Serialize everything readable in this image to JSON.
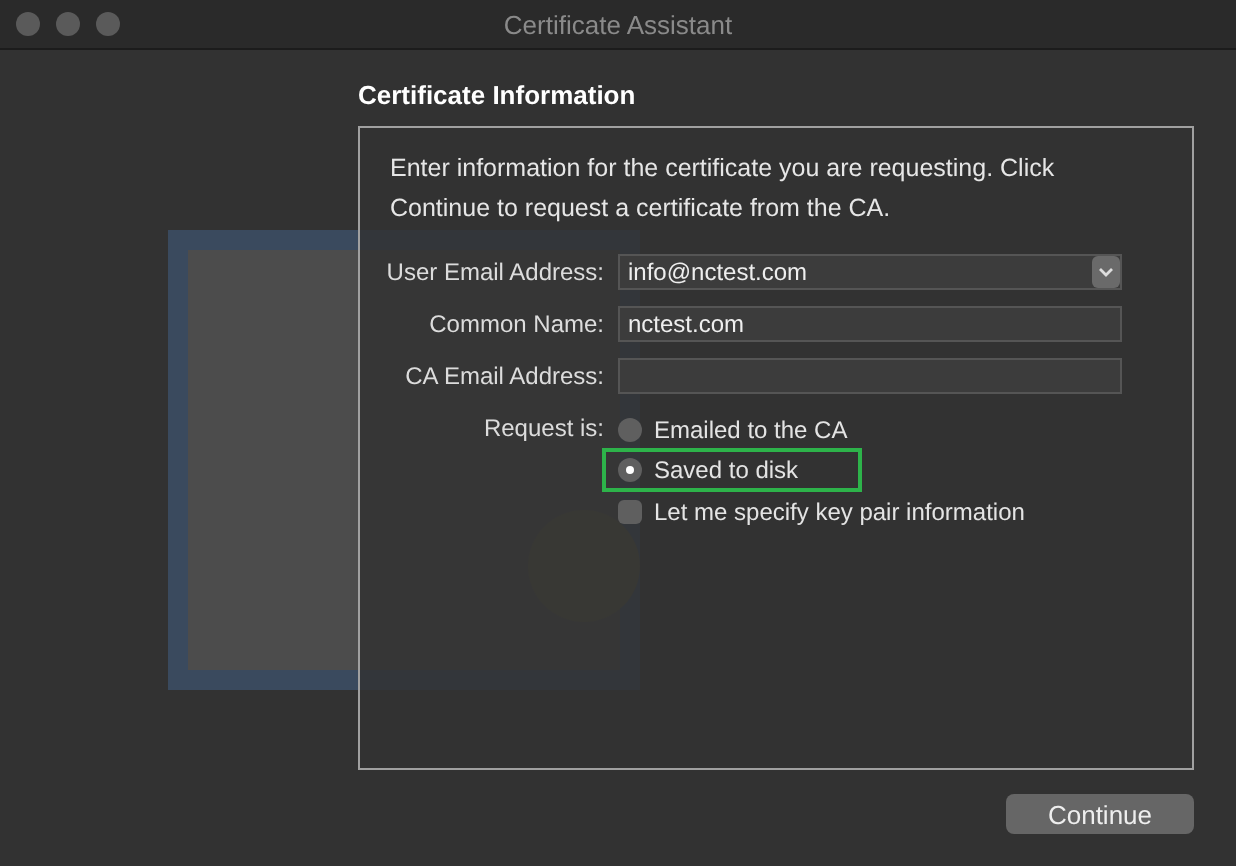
{
  "window": {
    "title": "Certificate Assistant"
  },
  "heading": "Certificate Information",
  "intro": "Enter information for the certificate you are requesting. Click Continue to request a certificate from the CA.",
  "fields": [
    {
      "label": "User Email Address:",
      "value": "info@nctest.com",
      "kind": "combo"
    },
    {
      "label": "Common Name:",
      "value": "nctest.com",
      "kind": "text"
    },
    {
      "label": "CA Email Address:",
      "kind": "text"
    }
  ],
  "request": {
    "label": "Request is:",
    "options": [
      {
        "label": "Emailed to the CA",
        "selected": false,
        "highlighted": false
      },
      {
        "label": "Saved to disk",
        "selected": true,
        "highlighted": true
      }
    ],
    "checkbox": {
      "label": "Let me specify key pair information",
      "checked": false
    }
  },
  "buttons": [
    {
      "label": "Continue"
    }
  ]
}
